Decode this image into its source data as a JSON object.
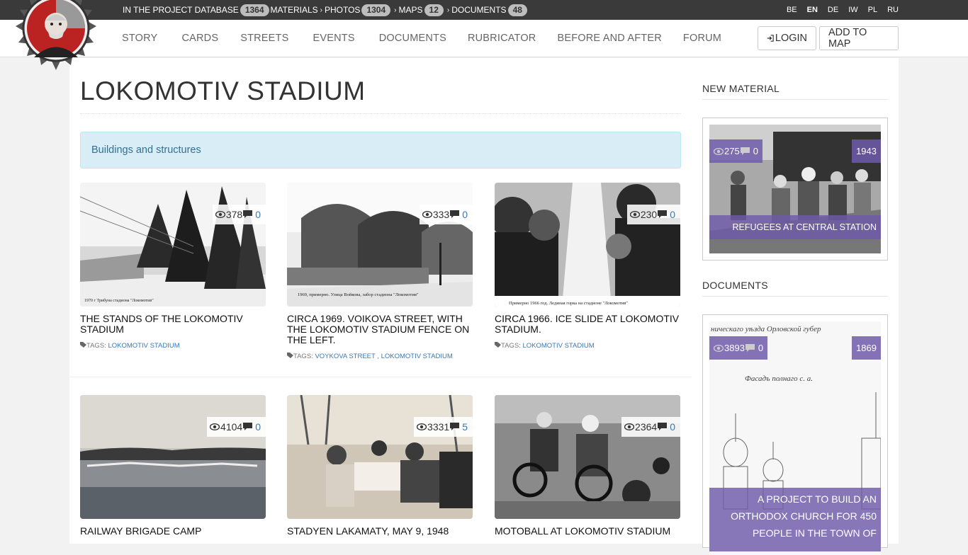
{
  "stats": {
    "prefix": "IN THE PROJECT DATABASE",
    "total": "1364",
    "materials_label": "MATERIALS",
    "photos_label": "PHOTOS",
    "photos": "1304",
    "maps_label": "MAPS",
    "maps": "12",
    "documents_label": "DOCUMENTS",
    "documents": "48"
  },
  "languages": [
    {
      "code": "BE",
      "active": false
    },
    {
      "code": "EN",
      "active": true
    },
    {
      "code": "DE",
      "active": false
    },
    {
      "code": "IW",
      "active": false
    },
    {
      "code": "PL",
      "active": false
    },
    {
      "code": "RU",
      "active": false
    }
  ],
  "nav": {
    "items": [
      "STORY",
      "CARDS",
      "STREETS",
      "EVENTS",
      "DOCUMENTS",
      "RUBRICATOR",
      "BEFORE AND AFTER",
      "FORUM"
    ],
    "login": "LOGIN",
    "add_to_map": "ADD TO MAP"
  },
  "page": {
    "title": "LOKOMOTIV STADIUM",
    "category": "Buildings and structures"
  },
  "cards": [
    {
      "title": "THE STANDS OF THE LOKOMOTIV STADIUM",
      "views": "378",
      "comments": "0",
      "tags_label": "TAGS:",
      "tags": [
        "LOKOMOTIV STADIUM"
      ]
    },
    {
      "title": "CIRCA 1969. VOIKOVA STREET, WITH THE LOKOMOTIV STADIUM FENCE ON THE LEFT.",
      "views": "333",
      "comments": "0",
      "tags_label": "TAGS:",
      "tags": [
        "VOYKOVA STREET",
        "LOKOMOTIV STADIUM"
      ]
    },
    {
      "title": "CIRCA 1966. ICE SLIDE AT LOKOMOTIV STADIUM.",
      "views": "230",
      "comments": "0",
      "tags_label": "TAGS:",
      "tags": [
        "LOKOMOTIV STADIUM"
      ]
    },
    {
      "title": "RAILWAY BRIGADE CAMP",
      "views": "4104",
      "comments": "0"
    },
    {
      "title": "STADYEN LAKAMATY, MAY 9, 1948",
      "views": "3331",
      "comments": "5"
    },
    {
      "title": "MOTOBALL AT LOKOMOTIV STADIUM",
      "views": "2364",
      "comments": "0"
    }
  ],
  "sidebar": {
    "new_material_heading": "NEW MATERIAL",
    "new_material": {
      "views": "275",
      "comments": "0",
      "year": "1943",
      "title": "REFUGEES AT CENTRAL STATION"
    },
    "documents_heading": "DOCUMENTS",
    "document": {
      "views": "3893",
      "comments": "0",
      "year": "1869",
      "title": "A PROJECT TO BUILD AN ORTHODOX CHURCH FOR 450 PEOPLE IN THE TOWN OF"
    }
  }
}
